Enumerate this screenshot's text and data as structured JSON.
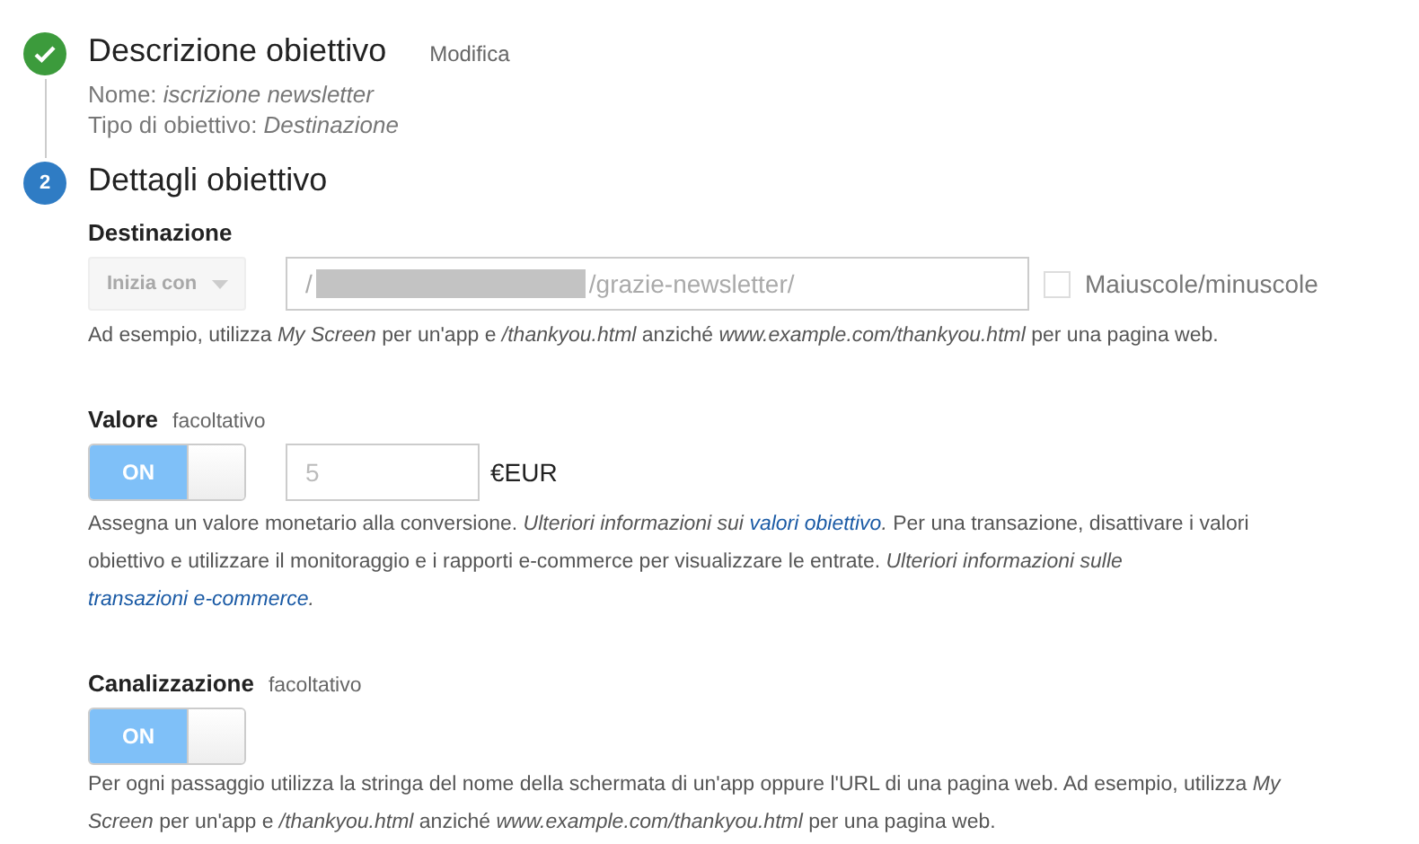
{
  "steps": [
    {
      "completed": true,
      "title": "Descrizione obiettivo",
      "action": "Modifica",
      "details": [
        {
          "label": "Nome:",
          "value": "iscrizione newsletter"
        },
        {
          "label": "Tipo di obiettivo:",
          "value": "Destinazione"
        }
      ]
    },
    {
      "number": "2",
      "completed": false,
      "title": "Dettagli obiettivo"
    }
  ],
  "sections": [
    {
      "kind": "destination",
      "label": "Destinazione",
      "match_type": {
        "label": "Inizia con",
        "disabled": true
      },
      "field": {
        "value_start": "/",
        "redacted": true,
        "value_end": "/grazie-newsletter/"
      },
      "case_sensitive": {
        "label": "Maiuscole/minuscole",
        "checked": false
      },
      "help": [
        {
          "kind": "text",
          "text": "Ad esempio, utilizza "
        },
        {
          "kind": "italic",
          "text": "My Screen"
        },
        {
          "kind": "text",
          "text": " per un'app e "
        },
        {
          "kind": "italic",
          "text": "/thankyou.html"
        },
        {
          "kind": "text",
          "text": " anziché "
        },
        {
          "kind": "italic",
          "text": "www.example.com/thankyou.html"
        },
        {
          "kind": "text",
          "text": " per una pagina web."
        }
      ]
    },
    {
      "kind": "value",
      "label": "Valore",
      "optional": "facoltativo",
      "toggle": {
        "label": "ON",
        "on": true
      },
      "amount": {
        "placeholder": "5"
      },
      "currency": "€EUR",
      "help": [
        {
          "kind": "text",
          "text": "Assegna un valore monetario alla conversione. "
        },
        {
          "kind": "italic",
          "text": "Ulteriori informazioni sui "
        },
        {
          "kind": "link",
          "text": "valori obiettivo"
        },
        {
          "kind": "italic",
          "text": "."
        },
        {
          "kind": "text",
          "text": " Per una transazione, disattivare i valori obiettivo e utilizzare il monitoraggio e i rapporti e-commerce per visualizzare le entrate. "
        },
        {
          "kind": "italic",
          "text": "Ulteriori informazioni sulle "
        },
        {
          "kind": "link",
          "text": "transazioni e-commerce"
        },
        {
          "kind": "italic",
          "text": "."
        }
      ]
    },
    {
      "kind": "funnel",
      "label": "Canalizzazione",
      "optional": "facoltativo",
      "toggle": {
        "label": "ON",
        "on": true
      },
      "help": [
        {
          "kind": "text",
          "text": "Per ogni passaggio utilizza la stringa del nome della schermata di un'app oppure l'URL di una pagina web. Ad esempio, utilizza "
        },
        {
          "kind": "italic",
          "text": "My Screen"
        },
        {
          "kind": "text",
          "text": " per un'app e "
        },
        {
          "kind": "italic",
          "text": "/thankyou.html"
        },
        {
          "kind": "text",
          "text": " anziché "
        },
        {
          "kind": "italic",
          "text": "www.example.com/thankyou.html"
        },
        {
          "kind": "text",
          "text": " per una pagina web."
        }
      ]
    }
  ]
}
